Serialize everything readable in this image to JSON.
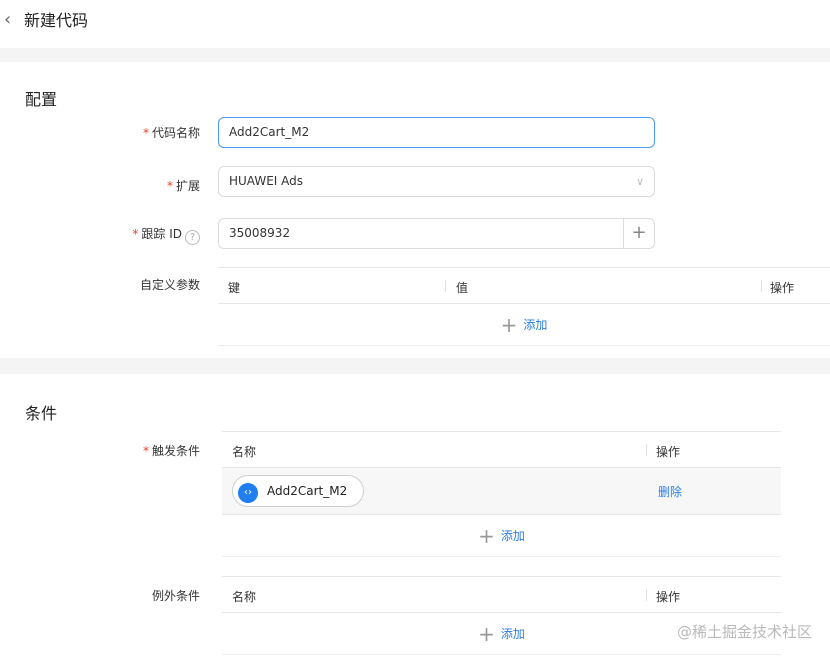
{
  "header": {
    "back_icon": "chevron-left-icon",
    "title": "新建代码"
  },
  "config": {
    "section_title": "配置",
    "code_name": {
      "label": "代码名称",
      "required": true,
      "value": "Add2Cart_M2"
    },
    "extension": {
      "label": "扩展",
      "required": true,
      "value": "HUAWEI Ads",
      "icon": "chevron-down-icon"
    },
    "tracking_id": {
      "label": "跟踪 ID",
      "required": true,
      "help_icon": "question-circle-icon",
      "help_glyph": "?",
      "value": "35008932",
      "add_icon": "plus-icon",
      "add_glyph": "+"
    },
    "custom_params": {
      "label": "自定义参数",
      "columns": [
        "键",
        "值",
        "操作"
      ],
      "add_label": "添加"
    }
  },
  "conditions": {
    "section_title": "条件",
    "trigger": {
      "label": "触发条件",
      "required": true,
      "columns": [
        "名称",
        "操作"
      ],
      "rows": [
        {
          "name": "Add2Cart_M2",
          "icon": "code-icon",
          "icon_glyph": "‹›",
          "action": "删除"
        }
      ],
      "add_label": "添加"
    },
    "exception": {
      "label": "例外条件",
      "columns": [
        "名称",
        "操作"
      ],
      "add_label": "添加"
    }
  },
  "plus_glyph": "+",
  "required_mark": "*",
  "watermark": "@稀土掘金技术社区",
  "colors": {
    "accent": "#2a7de1",
    "focus_border": "#4b9bf0",
    "required": "#e84026",
    "chip_icon": "#1f7ef0"
  }
}
